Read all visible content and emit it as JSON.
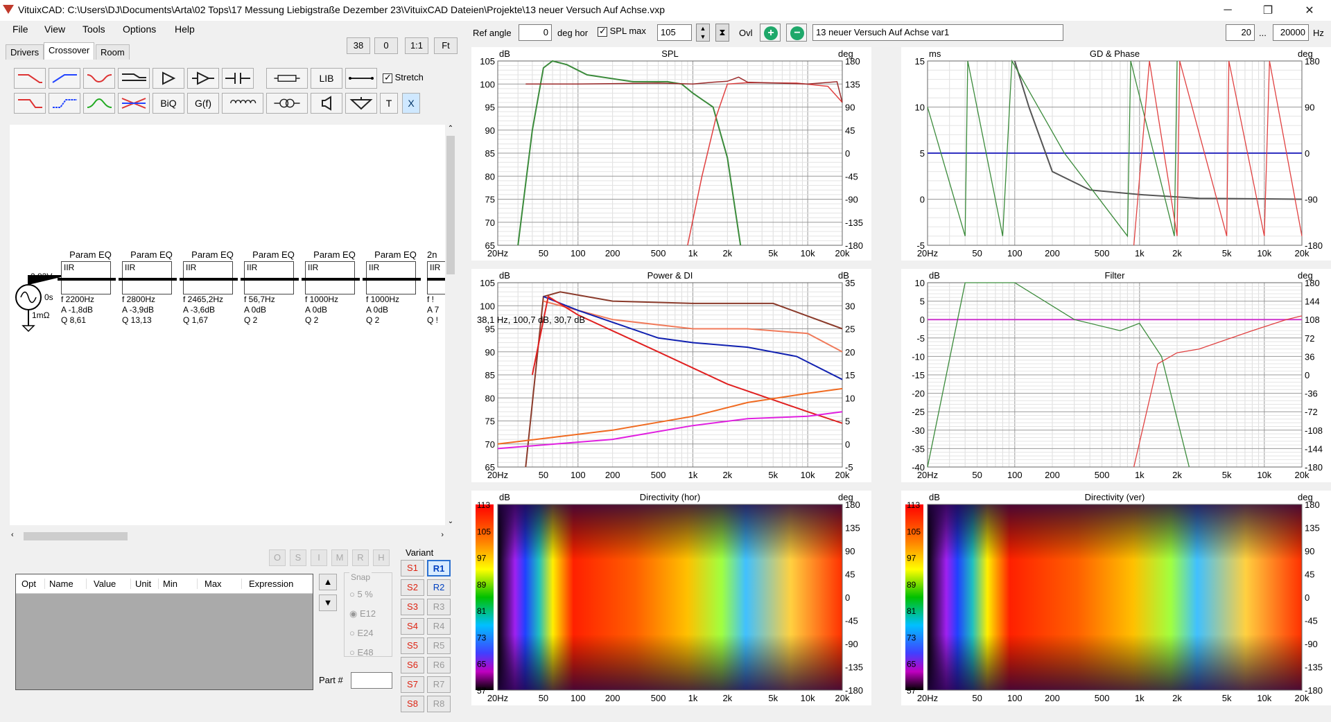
{
  "window": {
    "title": "VituixCAD: C:\\Users\\DJ\\Documents\\Arta\\02 Tops\\17 Messung Liebigstraße Dezember 23\\VituixCAD Dateien\\Projekte\\13 neuer Versuch Auf Achse.vxp",
    "minimize": "─",
    "restore": "❐",
    "close": "✕"
  },
  "menu": [
    "File",
    "View",
    "Tools",
    "Options",
    "Help"
  ],
  "tabs": [
    "Drivers",
    "Crossover",
    "Room"
  ],
  "zoom": {
    "value1": "38",
    "value2": "0",
    "one_to_one": "1:1",
    "fit": "Ft"
  },
  "toolbar": {
    "lib": "LIB",
    "biq": "BiQ",
    "gf": "G(f)",
    "t": "T",
    "x": "X",
    "stretch_label": "Stretch"
  },
  "source": {
    "voltage": "2,83V",
    "delay": "0s",
    "impedance": "1mΩ"
  },
  "peq_blocks": [
    {
      "title": "Param EQ",
      "type": "IIR",
      "f": "f   2200Hz",
      "a": "A  -1,8dB",
      "q": "Q  8,61"
    },
    {
      "title": "Param EQ",
      "type": "IIR",
      "f": "f   2800Hz",
      "a": "A  -3,9dB",
      "q": "Q  13,13"
    },
    {
      "title": "Param EQ",
      "type": "IIR",
      "f": "f   2465,2Hz",
      "a": "A  -3,6dB",
      "q": "Q  1,67"
    },
    {
      "title": "Param EQ",
      "type": "IIR",
      "f": "f   56,7Hz",
      "a": "A  0dB",
      "q": "Q  2"
    },
    {
      "title": "Param EQ",
      "type": "IIR",
      "f": "f   1000Hz",
      "a": "A  0dB",
      "q": "Q  2"
    },
    {
      "title": "Param EQ",
      "type": "IIR",
      "f": "f   1000Hz",
      "a": "A  0dB",
      "q": "Q  2"
    },
    {
      "title": "2n",
      "type": "IIR",
      "f": "f  !",
      "a": "A  7",
      "q": "Q  !"
    }
  ],
  "opt_buttons": [
    "O",
    "S",
    "I",
    "M",
    "R",
    "H"
  ],
  "opt_table": {
    "columns": [
      "Opt",
      "Name",
      "Value",
      "Unit",
      "Min",
      "Max",
      "Expression"
    ]
  },
  "snap": {
    "label": "Snap",
    "options": [
      "5 %",
      "E12",
      "E24",
      "E48"
    ],
    "selected": "E12"
  },
  "part_label": "Part #",
  "variant": {
    "label": "Variant",
    "s": [
      "S1",
      "S2",
      "S3",
      "S4",
      "S5",
      "S6",
      "S7",
      "S8"
    ],
    "r": [
      "R1",
      "R2",
      "R3",
      "R4",
      "R5",
      "R6",
      "R7",
      "R8"
    ]
  },
  "header": {
    "ref_angle_label": "Ref angle",
    "ref_angle_value": "0",
    "deg_hor_label": "deg hor",
    "spl_max_label": "SPL max",
    "spl_max_value": "105",
    "ovl_label": "Ovl",
    "variant_name": "13 neuer Versuch Auf Achse var1",
    "freq_min": "20",
    "freq_sep": "...",
    "freq_max": "20000",
    "hz_label": "Hz"
  },
  "x_ticks": [
    "20Hz",
    "50",
    "100",
    "200",
    "500",
    "1k",
    "2k",
    "5k",
    "10k",
    "20k"
  ],
  "charts": {
    "spl": {
      "title": "SPL",
      "left_unit": "dB",
      "right_unit": "deg",
      "left_ticks": [
        "105",
        "100",
        "95",
        "90",
        "85",
        "80",
        "75",
        "70",
        "65"
      ],
      "right_ticks": [
        "180",
        "135",
        "90",
        "45",
        "0",
        "-45",
        "-90",
        "-135",
        "-180"
      ]
    },
    "gd": {
      "title": "GD & Phase",
      "left_unit": "ms",
      "right_unit": "deg",
      "left_ticks": [
        "15",
        "10",
        "5",
        "0",
        "-5"
      ],
      "right_ticks": [
        "180",
        "90",
        "0",
        "-90",
        "-180"
      ]
    },
    "power": {
      "title": "Power & DI",
      "left_unit": "dB",
      "right_unit": "dB",
      "left_ticks": [
        "105",
        "100",
        "95",
        "90",
        "85",
        "80",
        "75",
        "70",
        "65"
      ],
      "right_ticks": [
        "35",
        "30",
        "25",
        "20",
        "15",
        "10",
        "5",
        "0",
        "-5"
      ],
      "cursor_readout": "38,1 Hz, 100,7 dB, 30,7 dB"
    },
    "filter": {
      "title": "Filter",
      "left_unit": "dB",
      "right_unit": "deg",
      "left_ticks": [
        "10",
        "5",
        "0",
        "-5",
        "-10",
        "-15",
        "-20",
        "-25",
        "-30",
        "-35",
        "-40"
      ],
      "right_ticks": [
        "180",
        "144",
        "108",
        "72",
        "36",
        "0",
        "-36",
        "-72",
        "-108",
        "-144",
        "-180"
      ]
    },
    "dir_hor": {
      "title": "Directivity (hor)",
      "left_unit": "dB",
      "right_unit": "deg",
      "scale_ticks": [
        "113",
        "105",
        "97",
        "89",
        "81",
        "73",
        "65",
        "57"
      ],
      "right_ticks": [
        "180",
        "135",
        "90",
        "45",
        "0",
        "-45",
        "-90",
        "-135",
        "-180"
      ]
    },
    "dir_ver": {
      "title": "Directivity (ver)",
      "left_unit": "dB",
      "right_unit": "deg",
      "scale_ticks": [
        "113",
        "105",
        "97",
        "89",
        "81",
        "73",
        "65",
        "57"
      ],
      "right_ticks": [
        "180",
        "135",
        "90",
        "45",
        "0",
        "-45",
        "-90",
        "-135",
        "-180"
      ]
    }
  },
  "colors": {
    "woofer": "#3a8a3a",
    "tweeter": "#e04040",
    "sum": "#9b2a2a",
    "gd": "#555555",
    "phase_target": "#3030c0",
    "filter_flat": "#cc33cc",
    "power_brown": "#8a3a2a",
    "power_salmon": "#f07a5a",
    "power_blue": "#1020b0",
    "power_red": "#e02020",
    "power_orange": "#f06a20",
    "power_magenta": "#e020e0"
  }
}
